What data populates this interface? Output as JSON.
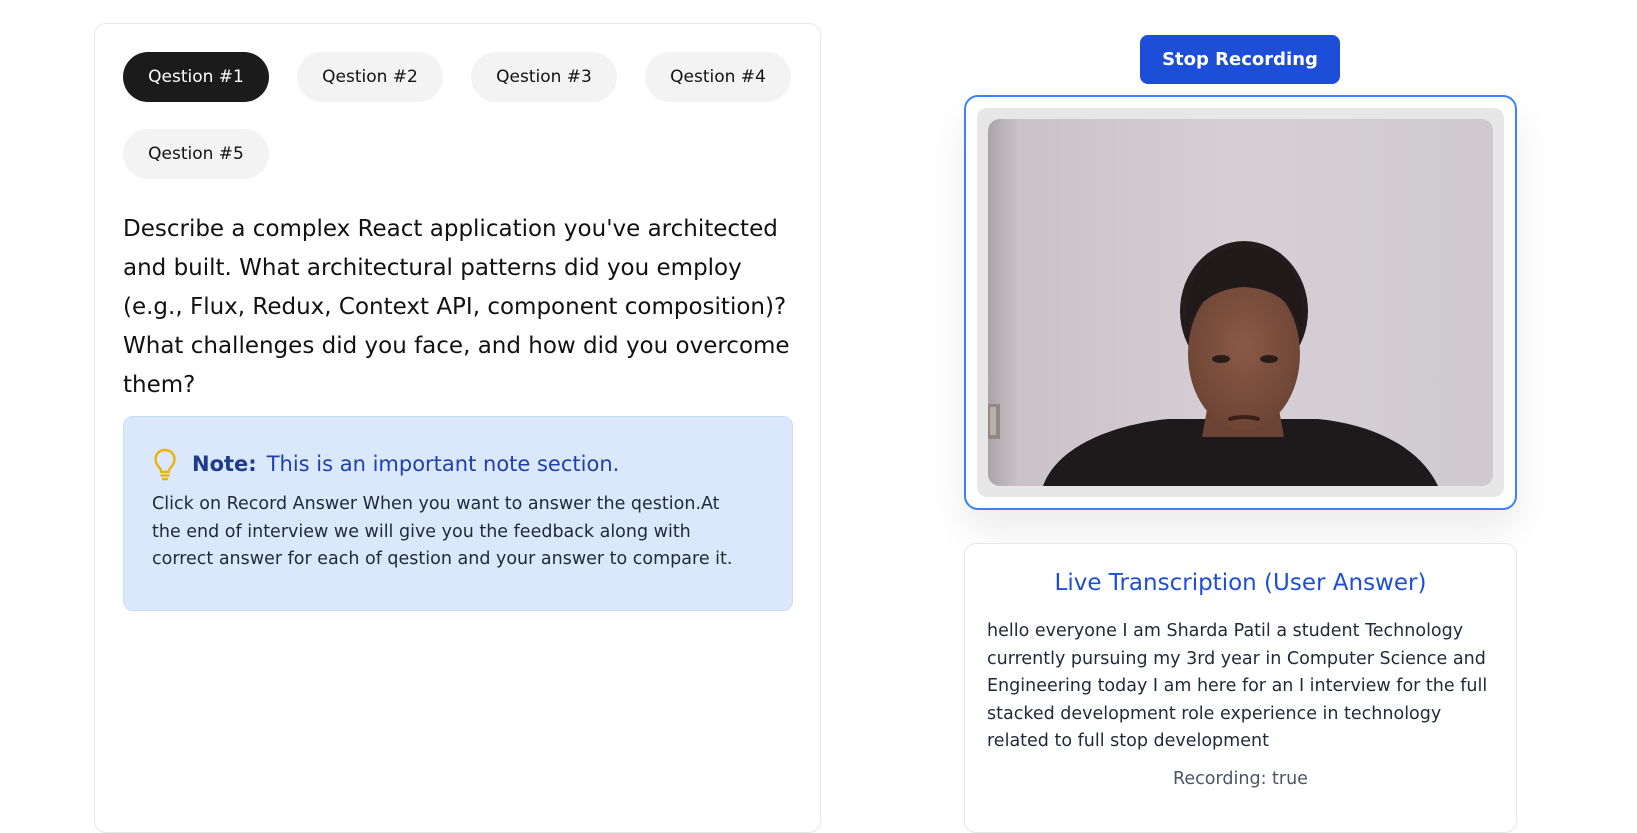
{
  "questions": {
    "tabs": [
      "Qestion #1",
      "Qestion #2",
      "Qestion #3",
      "Qestion #4",
      "Qestion #5"
    ],
    "active_index": 0,
    "current_text": "Describe a complex React application you've architected and built. What architectural patterns did you employ (e.g., Flux, Redux, Context API, component composition)? What challenges did you face, and how did you overcome them?"
  },
  "note": {
    "icon": "lightbulb-icon",
    "label": "Note:",
    "title": "This is an important note section.",
    "body": "Click on Record Answer When you want to answer the qestion.At the end of interview we will give you the feedback along with correct answer for each of qestion and your answer to compare it."
  },
  "recording": {
    "button_label": "Stop Recording",
    "status": "Recording: true"
  },
  "transcription": {
    "title": "Live Transcription (User Answer)",
    "text": "hello everyone I am Sharda Patil a student Technology currently pursuing my 3rd year in Computer Science and Engineering today I am here for an I interview for the full stacked development role experience in technology related to full stop development"
  },
  "colors": {
    "accent": "#1d4ed8",
    "active_tab": "#1b1b1b",
    "note_bg": "#dbe8fc",
    "bulb": "#eab308"
  }
}
